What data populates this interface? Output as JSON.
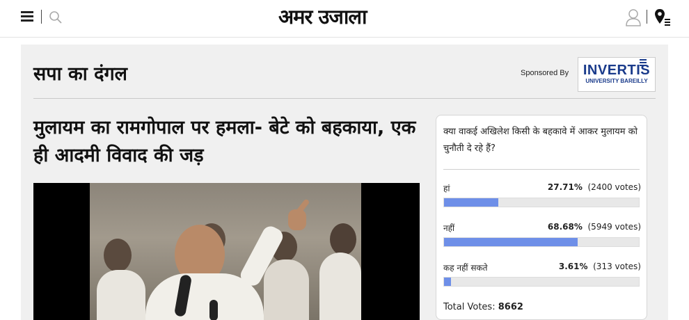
{
  "header": {
    "logo_text": "अमर उजाला",
    "icons": [
      "menu-icon",
      "search-icon",
      "user-icon",
      "location-icon"
    ]
  },
  "section": {
    "title": "सपा का दंगल",
    "sponsor_label": "Sponsored By",
    "sponsor_logo_line1": "INVERTIS",
    "sponsor_logo_line2": "UNIVERSITY BAREILLY"
  },
  "article": {
    "headline": "मुलायम का रामगोपाल पर हमला- बेटे को बहकाया, एक ही आदमी विवाद की जड़"
  },
  "poll": {
    "question": "क्या वाकई अखिलेश किसी के बहकावे में आकर मुलायम को चुनौती दे रहे हैं?",
    "options": [
      {
        "label": "हां",
        "percent_text": "27.71%",
        "votes_text": "(2400 votes)",
        "percent": 27.71
      },
      {
        "label": "नहीं",
        "percent_text": "68.68%",
        "votes_text": "(5949 votes)",
        "percent": 68.68
      },
      {
        "label": "कह नहीं सकते",
        "percent_text": "3.61%",
        "votes_text": "(313 votes)",
        "percent": 3.61
      }
    ],
    "total_label": "Total Votes:",
    "total_value": "8662",
    "bar_color": "#6e8fe8"
  }
}
